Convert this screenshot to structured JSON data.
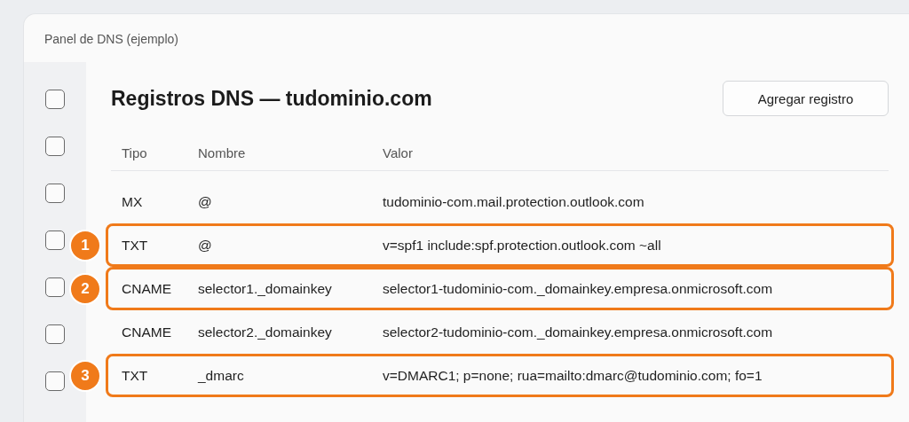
{
  "window": {
    "title": "Panel de DNS (ejemplo)"
  },
  "sidebar": {
    "checkboxes": [
      {
        "checked": false
      },
      {
        "checked": false
      },
      {
        "checked": false
      },
      {
        "checked": false
      },
      {
        "checked": false
      },
      {
        "checked": false
      },
      {
        "checked": false
      }
    ]
  },
  "heading": "Registros DNS — tudominio.com",
  "add_button": "Agregar registro",
  "table": {
    "columns": [
      "Tipo",
      "Nombre",
      "Valor"
    ],
    "rows": [
      {
        "cells": [
          "MX",
          "@",
          "tudominio-com.mail.protection.outlook.com"
        ],
        "highlighted": false
      },
      {
        "cells": [
          "TXT",
          "@",
          "v=spf1 include:spf.protection.outlook.com ~all"
        ],
        "highlighted": true,
        "badge": "1"
      },
      {
        "cells": [
          "CNAME",
          "selector1._domainkey",
          "selector1-tudominio-com._domainkey.empresa.onmicrosoft.com"
        ],
        "highlighted": true,
        "badge": "2"
      },
      {
        "cells": [
          "CNAME",
          "selector2._domainkey",
          "selector2-tudominio-com._domainkey.empresa.onmicrosoft.com"
        ],
        "highlighted": false
      },
      {
        "cells": [
          "TXT",
          "_dmarc",
          "v=DMARC1; p=none; rua=mailto:dmarc@tudominio.com; fo=1"
        ],
        "highlighted": true,
        "badge": "3"
      }
    ]
  }
}
